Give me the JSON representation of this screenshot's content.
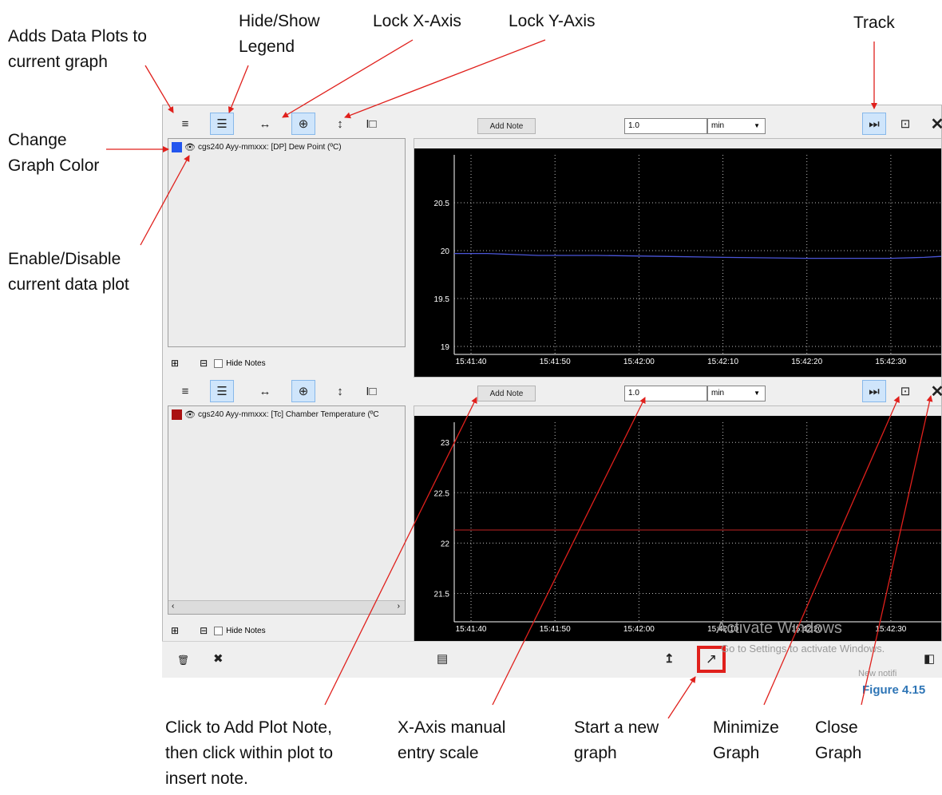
{
  "annotations": {
    "adds_data_plots": "Adds Data Plots to\ncurrent graph",
    "hide_show_legend": "Hide/Show\nLegend",
    "lock_x_axis": "Lock X-Axis",
    "lock_y_axis": "Lock Y-Axis",
    "track": "Track",
    "change_graph_color": "Change\nGraph Color",
    "enable_disable": "Enable/Disable\ncurrent data plot",
    "add_plot_note": "Click to Add Plot Note,\nthen click within plot to\ninsert note.",
    "x_axis_scale": "X-Axis manual\nentry scale",
    "start_new_graph": "Start a new\ngraph",
    "minimize_graph": "Minimize\nGraph",
    "close_graph": "Close\nGraph",
    "figure_label": "Figure 4.15"
  },
  "accent_colors": {
    "figure_label": "#2e75b6",
    "annotation_arrow": "#e0201c",
    "highlight_box": "#e0201c",
    "toolbar_active": "#cfe5fb"
  },
  "icons": {
    "add_plots": "list-check-icon",
    "legend": "list-icon",
    "lock_x": "horizontal-arrows-icon",
    "crosshair": "crosshair-icon",
    "lock_y": "vertical-arrows-icon",
    "cursor": "text-cursor-icon",
    "track": "fast-forward-icon",
    "minimize": "collapse-icon",
    "close": "close-icon"
  },
  "graphs": [
    {
      "add_note_label": "Add Note",
      "scale_value": "1.0",
      "scale_unit": "min",
      "hide_notes_label": "Hide Notes",
      "legend": {
        "label": "cgs240 Ayy-mmxxx: [DP] Dew Point (ºC)",
        "color": "#2255ee"
      }
    },
    {
      "add_note_label": "Add Note",
      "scale_value": "1.0",
      "scale_unit": "min",
      "hide_notes_label": "Hide Notes",
      "legend": {
        "label": "cgs240 Ayy-mmxxx: [Tc] Chamber Temperature (ºC",
        "color": "#aa1111"
      }
    }
  ],
  "chart_data": [
    {
      "type": "line",
      "xlabel": "",
      "ylabel": "",
      "x_ticks": [
        "15:41:40",
        "15:41:50",
        "15:42:00",
        "15:42:10",
        "15:42:20",
        "15:42:30"
      ],
      "y_ticks": [
        "19",
        "19.5",
        "20",
        "20.5"
      ],
      "ylim": [
        18.95,
        21.0
      ],
      "grid": true,
      "series": [
        {
          "color": "#4a55d8",
          "x": [
            "15:41:38",
            "15:41:42",
            "15:41:48",
            "15:41:55",
            "15:42:03",
            "15:42:10",
            "15:42:20",
            "15:42:30",
            "15:42:34",
            "15:42:36"
          ],
          "y": [
            19.97,
            19.97,
            19.95,
            19.95,
            19.94,
            19.93,
            19.92,
            19.92,
            19.93,
            19.94
          ]
        }
      ]
    },
    {
      "type": "line",
      "xlabel": "",
      "ylabel": "",
      "x_ticks": [
        "15:41:40",
        "15:41:50",
        "15:42:00",
        "15:42:10",
        "15:42:20",
        "15:42:30"
      ],
      "y_ticks": [
        "21.5",
        "22",
        "22.5",
        "23"
      ],
      "ylim": [
        21.25,
        23.2
      ],
      "grid": true,
      "series": [
        {
          "color": "#9a1e1e",
          "x": [
            "15:41:38",
            "15:42:36"
          ],
          "y": [
            22.13,
            22.13
          ]
        }
      ]
    }
  ],
  "watermark": {
    "title": "Activate Windows",
    "subtitle": "Go to Settings to activate Windows."
  },
  "notification_peek": "New notifi"
}
